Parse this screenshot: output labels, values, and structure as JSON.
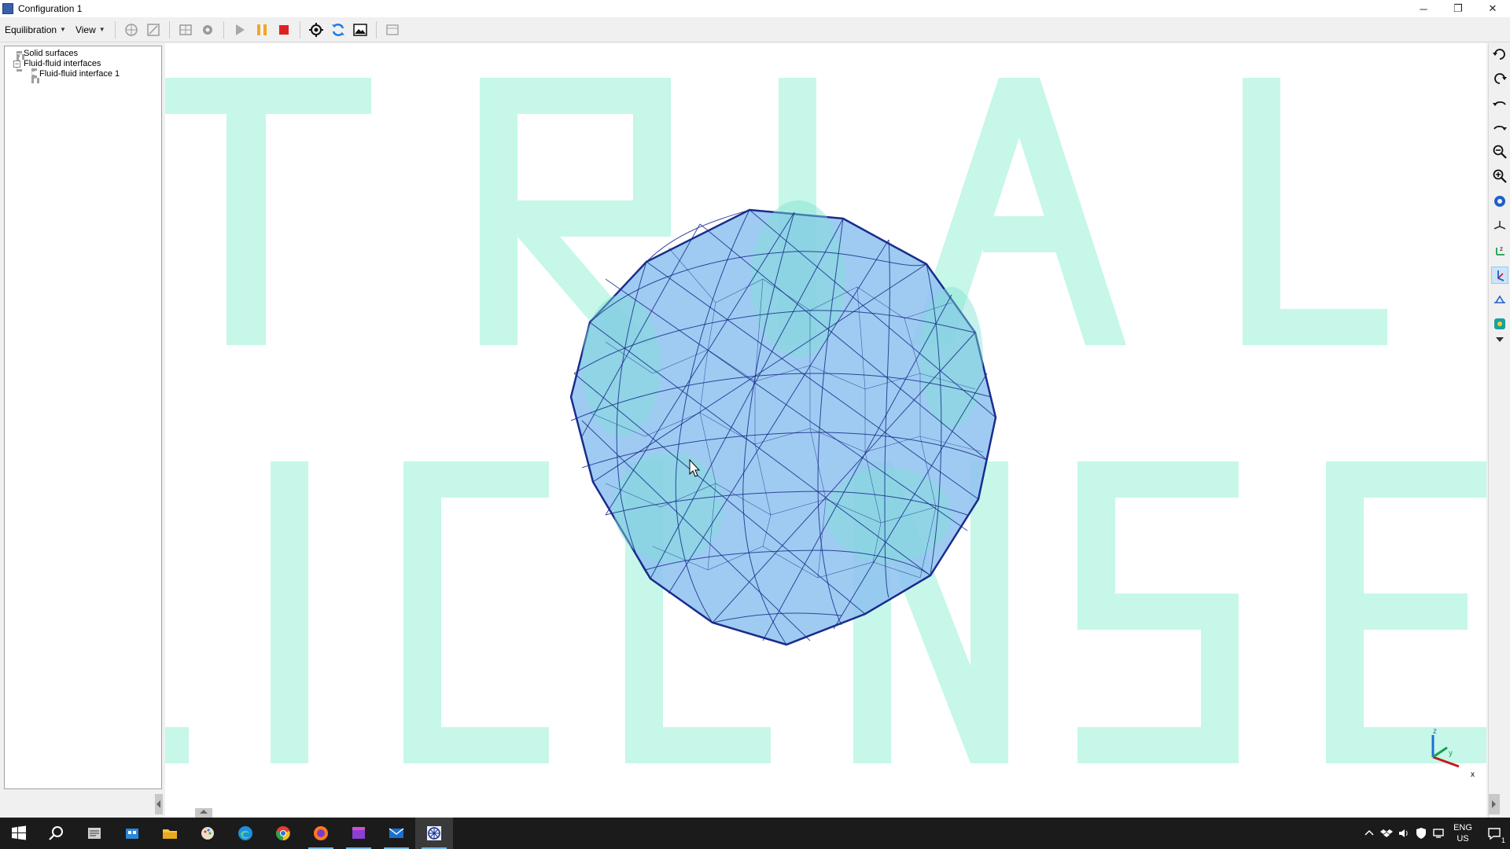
{
  "window": {
    "title": "Configuration 1",
    "controls": {
      "minimize": "─",
      "restore": "❐",
      "close": "✕"
    }
  },
  "toolbar": {
    "menus": [
      {
        "label": "Equilibration"
      },
      {
        "label": "View"
      }
    ],
    "buttons": [
      {
        "name": "model-icon"
      },
      {
        "name": "edit-icon"
      },
      {
        "name": "mesh-icon"
      },
      {
        "name": "settings-gear-icon"
      },
      {
        "name": "play-icon"
      },
      {
        "name": "pause-icon"
      },
      {
        "name": "stop-icon"
      },
      {
        "name": "target-icon"
      },
      {
        "name": "refresh-icon"
      },
      {
        "name": "image-icon"
      },
      {
        "name": "panel-icon"
      }
    ],
    "colors": {
      "pause": "#f5a623",
      "stop": "#e02020",
      "refresh": "#1e7be0"
    }
  },
  "tree": {
    "items": [
      {
        "label": "Solid surfaces",
        "level": 0
      },
      {
        "label": "Fluid-fluid interfaces",
        "level": 0,
        "expanded": true
      },
      {
        "label": "Fluid-fluid interface 1",
        "level": 1
      }
    ]
  },
  "viewport": {
    "watermark": {
      "line1": "TRIAL",
      "line2": "LICENSE",
      "color": "#c6f7e8"
    },
    "mesh": {
      "shape": "triangulated sphere",
      "fill": "#8ec2f0",
      "edge": "#1a2d8c"
    },
    "axis_triad": {
      "z": "z",
      "y": "y",
      "x": "x"
    }
  },
  "right_toolbar": {
    "buttons": [
      "rotate-left-icon",
      "rotate-right-icon",
      "undo-view-icon",
      "redo-view-icon",
      "zoom-out-icon",
      "zoom-in-icon",
      "view-settings-gear-icon",
      "axis-xyz-icon",
      "axis-z-icon",
      "axis-y-icon",
      "axis-x-icon",
      "render-mode-icon",
      "more-dropdown-icon"
    ]
  },
  "taskbar": {
    "apps": [
      "windows-start-icon",
      "search-icon",
      "notes-app-icon",
      "store-icon",
      "file-explorer-icon",
      "paint-icon",
      "edge-icon",
      "chrome-icon",
      "firefox-icon",
      "video-editor-icon",
      "mail-icon",
      "surface-evolver-icon"
    ],
    "tray": {
      "lang_line1": "ENG",
      "lang_line2": "US",
      "notification_count": "1"
    }
  }
}
